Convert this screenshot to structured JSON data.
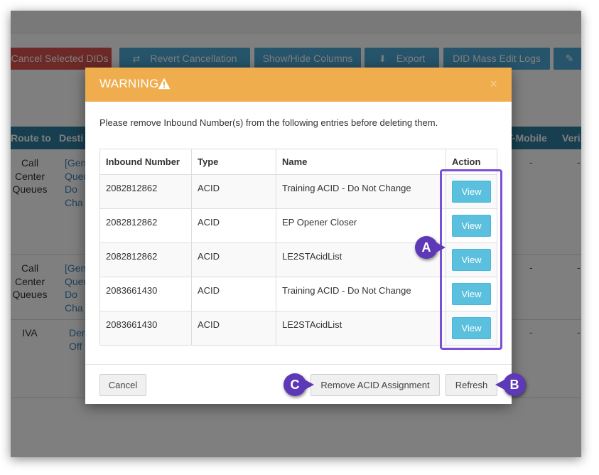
{
  "toolbar": {
    "cancel_selected_dids": "Cancel Selected DIDs",
    "revert_cancellation": "Revert Cancellation",
    "show_hide_columns": "Show/Hide Columns",
    "export": "Export",
    "did_mass_edit_logs": "DID Mass Edit Logs"
  },
  "grid": {
    "headers": {
      "route_to": "Route to",
      "destination": "Desti",
      "t_mobile": "T-Mobile",
      "verizon": "Veriz"
    },
    "rows": [
      {
        "route_to": "Call Center Queues",
        "destination": "[Gen Queu Do Cha",
        "t_mobile": "-",
        "verizon": "-"
      },
      {
        "route_to": "Call Center Queues",
        "destination": "[Gen Queu Do Cha",
        "t_mobile": "-",
        "verizon": "-"
      },
      {
        "route_to": "IVA",
        "destination": "Der Off",
        "t_mobile": "-",
        "verizon": "-"
      }
    ]
  },
  "modal": {
    "title": "WARNING",
    "close": "×",
    "message": "Please remove Inbound Number(s) from the following entries before deleting them.",
    "columns": {
      "inbound_number": "Inbound Number",
      "type": "Type",
      "name": "Name",
      "action": "Action"
    },
    "rows": [
      {
        "inbound_number": "2082812862",
        "type": "ACID",
        "name": "Training ACID - Do Not Change",
        "action": "View"
      },
      {
        "inbound_number": "2082812862",
        "type": "ACID",
        "name": "EP Opener Closer",
        "action": "View"
      },
      {
        "inbound_number": "2082812862",
        "type": "ACID",
        "name": "LE2STAcidList",
        "action": "View"
      },
      {
        "inbound_number": "2083661430",
        "type": "ACID",
        "name": "Training ACID - Do Not Change",
        "action": "View"
      },
      {
        "inbound_number": "2083661430",
        "type": "ACID",
        "name": "LE2STAcidList",
        "action": "View"
      }
    ],
    "footer": {
      "cancel": "Cancel",
      "remove_acid_assignment": "Remove ACID Assignment",
      "refresh": "Refresh"
    }
  },
  "annotations": {
    "a": "A",
    "b": "B",
    "c": "C"
  },
  "colors": {
    "warning_header": "#f0ad4e",
    "view_button": "#5bc0de",
    "annotation": "#5d39b8",
    "grid_header": "#2e7ea0",
    "danger_button": "#d9534f"
  },
  "icons": {
    "warning": "warning-triangle-icon",
    "revert": "refresh-arrows-icon",
    "export": "download-icon",
    "edit": "edit-pencil-icon"
  }
}
